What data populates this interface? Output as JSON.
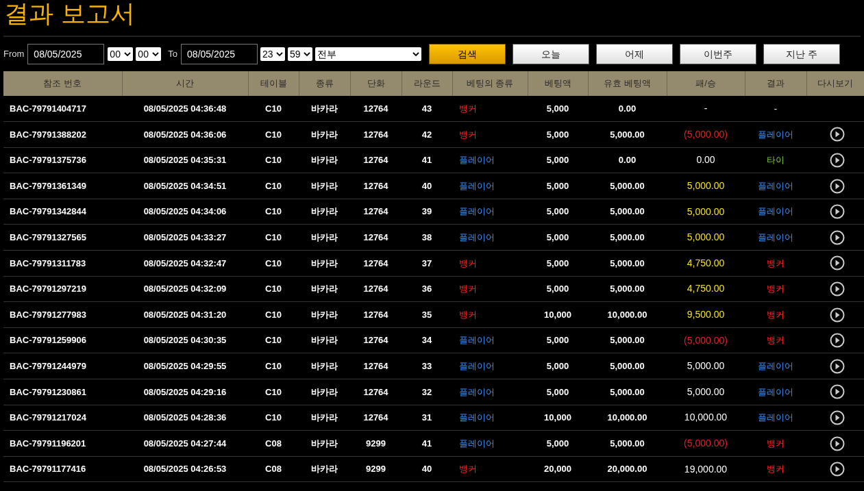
{
  "title": "결과 보고서",
  "filter": {
    "from_label": "From",
    "from_date": "08/05/2025",
    "from_hour": "00",
    "from_minute": "00",
    "to_label": "To",
    "to_date": "08/05/2025",
    "to_hour": "23",
    "to_minute": "59",
    "category": "전부"
  },
  "buttons": [
    {
      "label": "검색",
      "kind": "primary"
    },
    {
      "label": "오늘",
      "kind": "secondary"
    },
    {
      "label": "어제",
      "kind": "secondary"
    },
    {
      "label": "이번주",
      "kind": "secondary"
    },
    {
      "label": "지난 주",
      "kind": "secondary"
    }
  ],
  "table": {
    "columns": [
      "참조 번호",
      "시간",
      "테이블",
      "종류",
      "단화",
      "라운드",
      "베팅의 종류",
      "베팅액",
      "유효 베팅액",
      "패/승",
      "결과",
      "다시보기"
    ],
    "rows": [
      {
        "ref": "BAC-79791404717",
        "time": "08/05/2025 04:36:48",
        "table": "C10",
        "game": "바카라",
        "shoe": "12764",
        "round": "43",
        "bet": {
          "text": "뱅커",
          "kind": "banker"
        },
        "amount": "5,000",
        "valid": "0.00",
        "win_loss": {
          "text": "-"
        },
        "result": {
          "text": "-",
          "kind": "none"
        },
        "replay": false
      },
      {
        "ref": "BAC-79791388202",
        "time": "08/05/2025 04:36:06",
        "table": "C10",
        "game": "바카라",
        "shoe": "12764",
        "round": "42",
        "bet": {
          "text": "뱅커",
          "kind": "banker"
        },
        "amount": "5,000",
        "valid": "5,000.00",
        "win_loss": {
          "text": "(5,000.00)",
          "color": "#e0202a"
        },
        "result": {
          "text": "플레이어",
          "kind": "player"
        },
        "replay": true
      },
      {
        "ref": "BAC-79791375736",
        "time": "08/05/2025 04:35:31",
        "table": "C10",
        "game": "바카라",
        "shoe": "12764",
        "round": "41",
        "bet": {
          "text": "플레이어",
          "kind": "player"
        },
        "amount": "5,000",
        "valid": "0.00",
        "win_loss": {
          "text": "0.00",
          "color": "#ffffff"
        },
        "result": {
          "text": "타이",
          "kind": "tie"
        },
        "replay": true
      },
      {
        "ref": "BAC-79791361349",
        "time": "08/05/2025 04:34:51",
        "table": "C10",
        "game": "바카라",
        "shoe": "12764",
        "round": "40",
        "bet": {
          "text": "플레이어",
          "kind": "player"
        },
        "amount": "5,000",
        "valid": "5,000.00",
        "win_loss": {
          "text": "5,000.00",
          "color": "#f0e020"
        },
        "result": {
          "text": "플레이어",
          "kind": "player"
        },
        "replay": true
      },
      {
        "ref": "BAC-79791342844",
        "time": "08/05/2025 04:34:06",
        "table": "C10",
        "game": "바카라",
        "shoe": "12764",
        "round": "39",
        "bet": {
          "text": "플레이어",
          "kind": "player"
        },
        "amount": "5,000",
        "valid": "5,000.00",
        "win_loss": {
          "text": "5,000.00",
          "color": "#f0e020"
        },
        "result": {
          "text": "플레이어",
          "kind": "player"
        },
        "replay": true
      },
      {
        "ref": "BAC-79791327565",
        "time": "08/05/2025 04:33:27",
        "table": "C10",
        "game": "바카라",
        "shoe": "12764",
        "round": "38",
        "bet": {
          "text": "플레이어",
          "kind": "player"
        },
        "amount": "5,000",
        "valid": "5,000.00",
        "win_loss": {
          "text": "5,000.00",
          "color": "#f0e020"
        },
        "result": {
          "text": "플레이어",
          "kind": "player"
        },
        "replay": true
      },
      {
        "ref": "BAC-79791311783",
        "time": "08/05/2025 04:32:47",
        "table": "C10",
        "game": "바카라",
        "shoe": "12764",
        "round": "37",
        "bet": {
          "text": "뱅커",
          "kind": "banker"
        },
        "amount": "5,000",
        "valid": "5,000.00",
        "win_loss": {
          "text": "4,750.00",
          "color": "#f0e020"
        },
        "result": {
          "text": "뱅커",
          "kind": "banker"
        },
        "replay": true
      },
      {
        "ref": "BAC-79791297219",
        "time": "08/05/2025 04:32:09",
        "table": "C10",
        "game": "바카라",
        "shoe": "12764",
        "round": "36",
        "bet": {
          "text": "뱅커",
          "kind": "banker"
        },
        "amount": "5,000",
        "valid": "5,000.00",
        "win_loss": {
          "text": "4,750.00",
          "color": "#f0e020"
        },
        "result": {
          "text": "뱅커",
          "kind": "banker"
        },
        "replay": true
      },
      {
        "ref": "BAC-79791277983",
        "time": "08/05/2025 04:31:20",
        "table": "C10",
        "game": "바카라",
        "shoe": "12764",
        "round": "35",
        "bet": {
          "text": "뱅커",
          "kind": "banker"
        },
        "amount": "10,000",
        "valid": "10,000.00",
        "win_loss": {
          "text": "9,500.00",
          "color": "#f0e020"
        },
        "result": {
          "text": "뱅커",
          "kind": "banker"
        },
        "replay": true
      },
      {
        "ref": "BAC-79791259906",
        "time": "08/05/2025 04:30:35",
        "table": "C10",
        "game": "바카라",
        "shoe": "12764",
        "round": "34",
        "bet": {
          "text": "플레이어",
          "kind": "player"
        },
        "amount": "5,000",
        "valid": "5,000.00",
        "win_loss": {
          "text": "(5,000.00)",
          "color": "#e0202a"
        },
        "result": {
          "text": "뱅커",
          "kind": "banker"
        },
        "replay": true
      },
      {
        "ref": "BAC-79791244979",
        "time": "08/05/2025 04:29:55",
        "table": "C10",
        "game": "바카라",
        "shoe": "12764",
        "round": "33",
        "bet": {
          "text": "플레이어",
          "kind": "player"
        },
        "amount": "5,000",
        "valid": "5,000.00",
        "win_loss": {
          "text": "5,000.00",
          "color": "#ffffff"
        },
        "result": {
          "text": "플레이어",
          "kind": "player"
        },
        "replay": true
      },
      {
        "ref": "BAC-79791230861",
        "time": "08/05/2025 04:29:16",
        "table": "C10",
        "game": "바카라",
        "shoe": "12764",
        "round": "32",
        "bet": {
          "text": "플레이어",
          "kind": "player"
        },
        "amount": "5,000",
        "valid": "5,000.00",
        "win_loss": {
          "text": "5,000.00",
          "color": "#ffffff"
        },
        "result": {
          "text": "플레이어",
          "kind": "player"
        },
        "replay": true
      },
      {
        "ref": "BAC-79791217024",
        "time": "08/05/2025 04:28:36",
        "table": "C10",
        "game": "바카라",
        "shoe": "12764",
        "round": "31",
        "bet": {
          "text": "플레이어",
          "kind": "player"
        },
        "amount": "10,000",
        "valid": "10,000.00",
        "win_loss": {
          "text": "10,000.00",
          "color": "#ffffff"
        },
        "result": {
          "text": "플레이어",
          "kind": "player"
        },
        "replay": true
      },
      {
        "ref": "BAC-79791196201",
        "time": "08/05/2025 04:27:44",
        "table": "C08",
        "game": "바카라",
        "shoe": "9299",
        "round": "41",
        "bet": {
          "text": "플레이어",
          "kind": "player"
        },
        "amount": "5,000",
        "valid": "5,000.00",
        "win_loss": {
          "text": "(5,000.00)",
          "color": "#e0202a"
        },
        "result": {
          "text": "뱅커",
          "kind": "banker"
        },
        "replay": true
      },
      {
        "ref": "BAC-79791177416",
        "time": "08/05/2025 04:26:53",
        "table": "C08",
        "game": "바카라",
        "shoe": "9299",
        "round": "40",
        "bet": {
          "text": "뱅커",
          "kind": "banker"
        },
        "amount": "20,000",
        "valid": "20,000.00",
        "win_loss": {
          "text": "19,000.00",
          "color": "#ffffff"
        },
        "result": {
          "text": "뱅커",
          "kind": "banker"
        },
        "replay": true
      }
    ]
  }
}
